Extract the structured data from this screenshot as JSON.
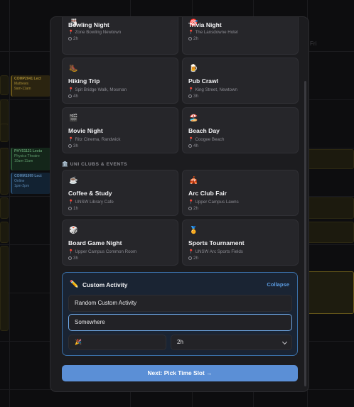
{
  "background": {
    "day_label": "Fri",
    "events": [
      {
        "title": "COMP2041 Lect",
        "sub1": "Mathews",
        "sub2": "9am-11am"
      },
      {
        "title": "PHYS1121 Lectu",
        "sub1": "Physics Theatre",
        "sub2": "10am-11am"
      },
      {
        "title": "COMM1999 Lect",
        "sub1": "Online",
        "sub2": "1pm-2pm"
      }
    ]
  },
  "top_row": [
    {
      "emoji": "🎳",
      "name": "Bowling Night",
      "location": "Zone Bowling Newtown",
      "duration": "2h"
    },
    {
      "emoji": "🎯",
      "name": "Trivia Night",
      "location": "The Lansdowne Hotel",
      "duration": "2h"
    }
  ],
  "activities": [
    {
      "emoji": "🥾",
      "name": "Hiking Trip",
      "location": "Spit Bridge Walk, Mosman",
      "duration": "4h"
    },
    {
      "emoji": "🍺",
      "name": "Pub Crawl",
      "location": "King Street, Newtown",
      "duration": "3h"
    },
    {
      "emoji": "🎬",
      "name": "Movie Night",
      "location": "Ritz Cinema, Randwick",
      "duration": "3h"
    },
    {
      "emoji": "🏖️",
      "name": "Beach Day",
      "location": "Coogee Beach",
      "duration": "4h"
    }
  ],
  "section": {
    "icon": "🏛️",
    "label": "UNI CLUBS & EVENTS"
  },
  "clubs": [
    {
      "emoji": "☕",
      "name": "Coffee & Study",
      "location": "UNSW Library Cafe",
      "duration": "1h"
    },
    {
      "emoji": "🎪",
      "name": "Arc Club Fair",
      "location": "Upper Campus Lawns",
      "duration": "2h"
    },
    {
      "emoji": "🎲",
      "name": "Board Game Night",
      "location": "Upper Campus Common Room",
      "duration": "3h"
    },
    {
      "emoji": "🏅",
      "name": "Sports Tournament",
      "location": "UNSW Arc Sports Fields",
      "duration": "2h"
    }
  ],
  "custom": {
    "icon": "✏️",
    "title": "Custom Activity",
    "collapse_label": "Collapse",
    "name_value": "Random Custom Activity",
    "location_value": "Somewhere",
    "emoji_value": "🎉",
    "duration_value": "2h"
  },
  "next_button": "Next: Pick Time Slot →",
  "colors": {
    "accent": "#5b8fd6",
    "panel_border": "#3a6ea5",
    "pin": "#e0555c"
  }
}
